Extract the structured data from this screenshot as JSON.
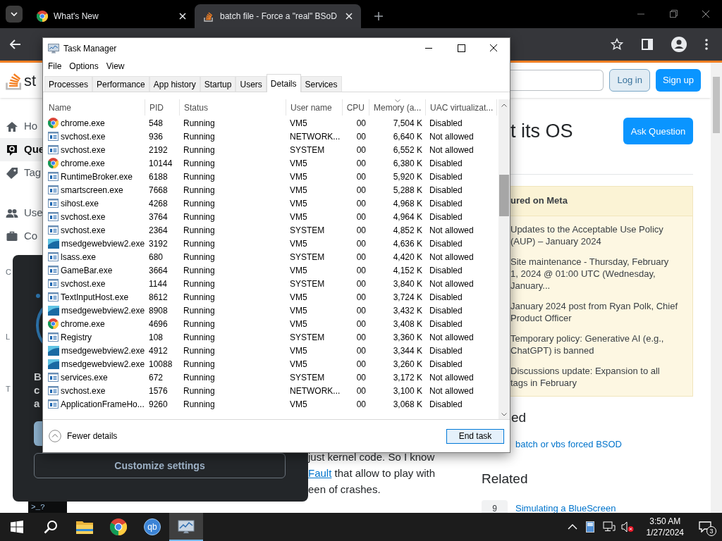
{
  "browser": {
    "tabs": [
      {
        "title": "What's New",
        "kind": "chrome",
        "selected": false
      },
      {
        "title": "batch file - Force a \"real\" BSoD",
        "kind": "stack",
        "selected": true
      }
    ]
  },
  "page": {
    "logo": "st",
    "login": "Log in",
    "signup": "Sign up",
    "nav": [
      {
        "label": "Ho",
        "kind": "home",
        "selected": false
      },
      {
        "label": "Que",
        "kind": "question",
        "selected": true
      },
      {
        "label": "Tag",
        "kind": "tag",
        "selected": false
      },
      {
        "label": "Use",
        "kind": "users",
        "selected": false
      },
      {
        "label": "Co",
        "kind": "briefcase",
        "selected": false
      }
    ],
    "nav_headings": [
      "C",
      "L",
      "T"
    ],
    "code_prompt": ">_?",
    "body": [
      {
        "text": "just kernel code. So I know"
      },
      {
        "link": "Fault",
        "text": "that allow to play with"
      },
      {
        "text": "een of crashes."
      }
    ],
    "heading": "t its OS",
    "ask_button": "Ask Question",
    "featured": {
      "title": "ured on Meta",
      "items": [
        "Updates to the Acceptable Use Policy (AUP) – January 2024",
        "Site maintenance - Thursday, February 1, 2024 @ 01:00 UTC (Wednesday, January...",
        "January 2024 post from Ryan Polk, Chief Product Officer",
        "Temporary policy: Generative AI (e.g., ChatGPT) is banned",
        "Discussions update: Expansion to all tags in February"
      ]
    },
    "linked_heading": "ed",
    "linked": [
      {
        "title": "batch or vbs forced BSOD"
      }
    ],
    "related_heading": "Related",
    "related": [
      {
        "score": "9",
        "title": "Simulating a BlueScreen"
      }
    ]
  },
  "cookie": {
    "lines": [
      "B",
      "c",
      "a"
    ],
    "customize": "Customize settings"
  },
  "task_manager": {
    "title": "Task Manager",
    "menu": [
      "File",
      "Options",
      "View"
    ],
    "tabs": [
      {
        "label": "Processes",
        "selected": false
      },
      {
        "label": "Performance",
        "selected": false
      },
      {
        "label": "App history",
        "selected": false
      },
      {
        "label": "Startup",
        "selected": false
      },
      {
        "label": "Users",
        "selected": false
      },
      {
        "label": "Details",
        "selected": true
      },
      {
        "label": "Services",
        "selected": false
      }
    ],
    "columns": [
      {
        "label": "Name",
        "sorted": false
      },
      {
        "label": "PID",
        "sorted": false
      },
      {
        "label": "Status",
        "sorted": false
      },
      {
        "label": "User name",
        "sorted": false
      },
      {
        "label": "CPU",
        "sorted": false
      },
      {
        "label": "Memory (a...",
        "sorted": true
      },
      {
        "label": "UAC virtualizat...",
        "sorted": false
      }
    ],
    "rows": [
      {
        "kind": "chrome",
        "cells": [
          "chrome.exe",
          "548",
          "Running",
          "VM5",
          "00",
          "7,504 K",
          "Disabled"
        ]
      },
      {
        "kind": "app",
        "cells": [
          "svchost.exe",
          "936",
          "Running",
          "NETWORK...",
          "00",
          "6,640 K",
          "Not allowed"
        ]
      },
      {
        "kind": "app",
        "cells": [
          "svchost.exe",
          "2192",
          "Running",
          "SYSTEM",
          "00",
          "6,552 K",
          "Not allowed"
        ]
      },
      {
        "kind": "chrome",
        "cells": [
          "chrome.exe",
          "10144",
          "Running",
          "VM5",
          "00",
          "6,380 K",
          "Disabled"
        ]
      },
      {
        "kind": "app",
        "cells": [
          "RuntimeBroker.exe",
          "6188",
          "Running",
          "VM5",
          "00",
          "5,920 K",
          "Disabled"
        ]
      },
      {
        "kind": "app",
        "cells": [
          "smartscreen.exe",
          "7668",
          "Running",
          "VM5",
          "00",
          "5,288 K",
          "Disabled"
        ]
      },
      {
        "kind": "app",
        "cells": [
          "sihost.exe",
          "4268",
          "Running",
          "VM5",
          "00",
          "4,968 K",
          "Disabled"
        ]
      },
      {
        "kind": "app",
        "cells": [
          "svchost.exe",
          "3764",
          "Running",
          "VM5",
          "00",
          "4,964 K",
          "Disabled"
        ]
      },
      {
        "kind": "app",
        "cells": [
          "svchost.exe",
          "2364",
          "Running",
          "SYSTEM",
          "00",
          "4,852 K",
          "Not allowed"
        ]
      },
      {
        "kind": "edge",
        "cells": [
          "msedgewebview2.exe",
          "3192",
          "Running",
          "VM5",
          "00",
          "4,636 K",
          "Disabled"
        ]
      },
      {
        "kind": "app",
        "cells": [
          "lsass.exe",
          "680",
          "Running",
          "SYSTEM",
          "00",
          "4,420 K",
          "Not allowed"
        ]
      },
      {
        "kind": "app",
        "cells": [
          "GameBar.exe",
          "3664",
          "Running",
          "VM5",
          "00",
          "4,152 K",
          "Disabled"
        ]
      },
      {
        "kind": "app",
        "cells": [
          "svchost.exe",
          "1144",
          "Running",
          "SYSTEM",
          "00",
          "3,840 K",
          "Not allowed"
        ]
      },
      {
        "kind": "app",
        "cells": [
          "TextInputHost.exe",
          "8612",
          "Running",
          "VM5",
          "00",
          "3,724 K",
          "Disabled"
        ]
      },
      {
        "kind": "edge",
        "cells": [
          "msedgewebview2.exe",
          "8908",
          "Running",
          "VM5",
          "00",
          "3,432 K",
          "Disabled"
        ]
      },
      {
        "kind": "chrome",
        "cells": [
          "chrome.exe",
          "4696",
          "Running",
          "VM5",
          "00",
          "3,408 K",
          "Disabled"
        ]
      },
      {
        "kind": "app",
        "cells": [
          "Registry",
          "108",
          "Running",
          "SYSTEM",
          "00",
          "3,360 K",
          "Not allowed"
        ]
      },
      {
        "kind": "edge",
        "cells": [
          "msedgewebview2.exe",
          "4912",
          "Running",
          "VM5",
          "00",
          "3,344 K",
          "Disabled"
        ]
      },
      {
        "kind": "edge",
        "cells": [
          "msedgewebview2.exe",
          "10088",
          "Running",
          "VM5",
          "00",
          "3,260 K",
          "Disabled"
        ]
      },
      {
        "kind": "app",
        "cells": [
          "services.exe",
          "672",
          "Running",
          "SYSTEM",
          "00",
          "3,172 K",
          "Not allowed"
        ]
      },
      {
        "kind": "app",
        "cells": [
          "svchost.exe",
          "1576",
          "Running",
          "NETWORK...",
          "00",
          "3,100 K",
          "Not allowed"
        ]
      },
      {
        "kind": "app",
        "cells": [
          "ApplicationFrameHo...",
          "9260",
          "Running",
          "VM5",
          "00",
          "3,068 K",
          "Disabled"
        ]
      }
    ],
    "fewer": "Fewer details",
    "end_task": "End task"
  },
  "taskbar": {
    "apps": [
      {
        "kind": "explorer",
        "active": false
      },
      {
        "kind": "chrome",
        "active": false
      },
      {
        "kind": "qb",
        "label": "qb",
        "active": false
      },
      {
        "kind": "taskmanager",
        "active": true
      }
    ],
    "time": "3:50 AM",
    "date": "1/27/2024",
    "notifications": "3"
  }
}
